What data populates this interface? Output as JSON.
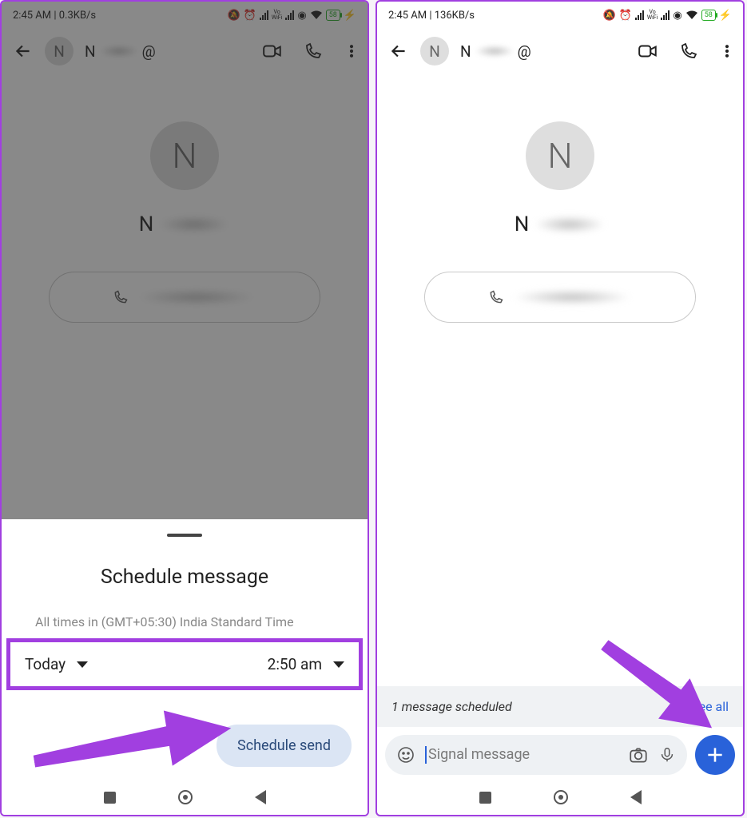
{
  "left": {
    "status": {
      "time": "2:45 AM | 0.3KB/s",
      "battery": "58"
    },
    "nav": {
      "initial": "N",
      "name_first": "N",
      "at": "@"
    },
    "contact": {
      "avatar_initial": "N",
      "name_first": "N"
    },
    "sheet": {
      "title": "Schedule message",
      "tz": "All times in (GMT+05:30) India Standard Time",
      "day": "Today",
      "time": "2:50 am",
      "button": "Schedule send"
    }
  },
  "right": {
    "status": {
      "time": "2:45 AM | 136KB/s",
      "battery": "58"
    },
    "nav": {
      "initial": "N",
      "name_first": "N",
      "at": "@"
    },
    "contact": {
      "avatar_initial": "N",
      "name_first": "N"
    },
    "banner": {
      "text": "1 message scheduled",
      "link": "See all"
    },
    "input": {
      "placeholder": "Signal message"
    }
  }
}
